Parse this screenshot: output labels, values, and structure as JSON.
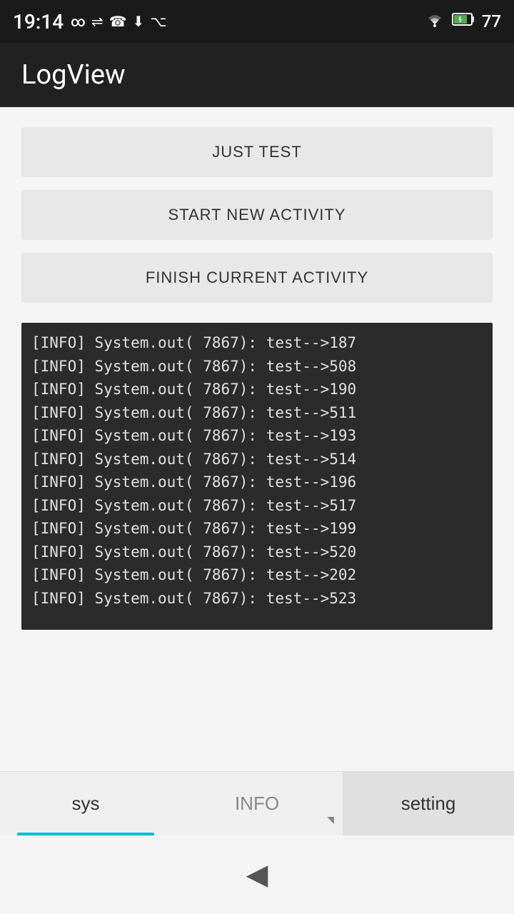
{
  "statusBar": {
    "time": "19:14",
    "batteryLevel": "77",
    "icons": [
      "∞",
      "⇄",
      "☎",
      "⬇",
      "✦"
    ]
  },
  "appBar": {
    "title": "LogView"
  },
  "buttons": {
    "justTest": "JUST TEST",
    "startNewActivity": "START NEW ACTIVITY",
    "finishCurrentActivity": "FINISH CURRENT ACTIVITY"
  },
  "logEntries": [
    "[INFO]   System.out( 7867): test-->187",
    "[INFO]   System.out( 7867): test-->508",
    "[INFO]   System.out( 7867): test-->190",
    "[INFO]   System.out( 7867): test-->511",
    "[INFO]   System.out( 7867): test-->193",
    "[INFO]   System.out( 7867): test-->514",
    "[INFO]   System.out( 7867): test-->196",
    "[INFO]   System.out( 7867): test-->517",
    "[INFO]   System.out( 7867): test-->199",
    "[INFO]   System.out( 7867): test-->520",
    "[INFO]   System.out( 7867): test-->202",
    "[INFO]   System.out( 7867): test-->523"
  ],
  "tabs": [
    {
      "id": "sys",
      "label": "sys",
      "active": true
    },
    {
      "id": "info",
      "label": "INFO",
      "active": false
    },
    {
      "id": "setting",
      "label": "setting",
      "active": false,
      "isSetting": true
    }
  ]
}
